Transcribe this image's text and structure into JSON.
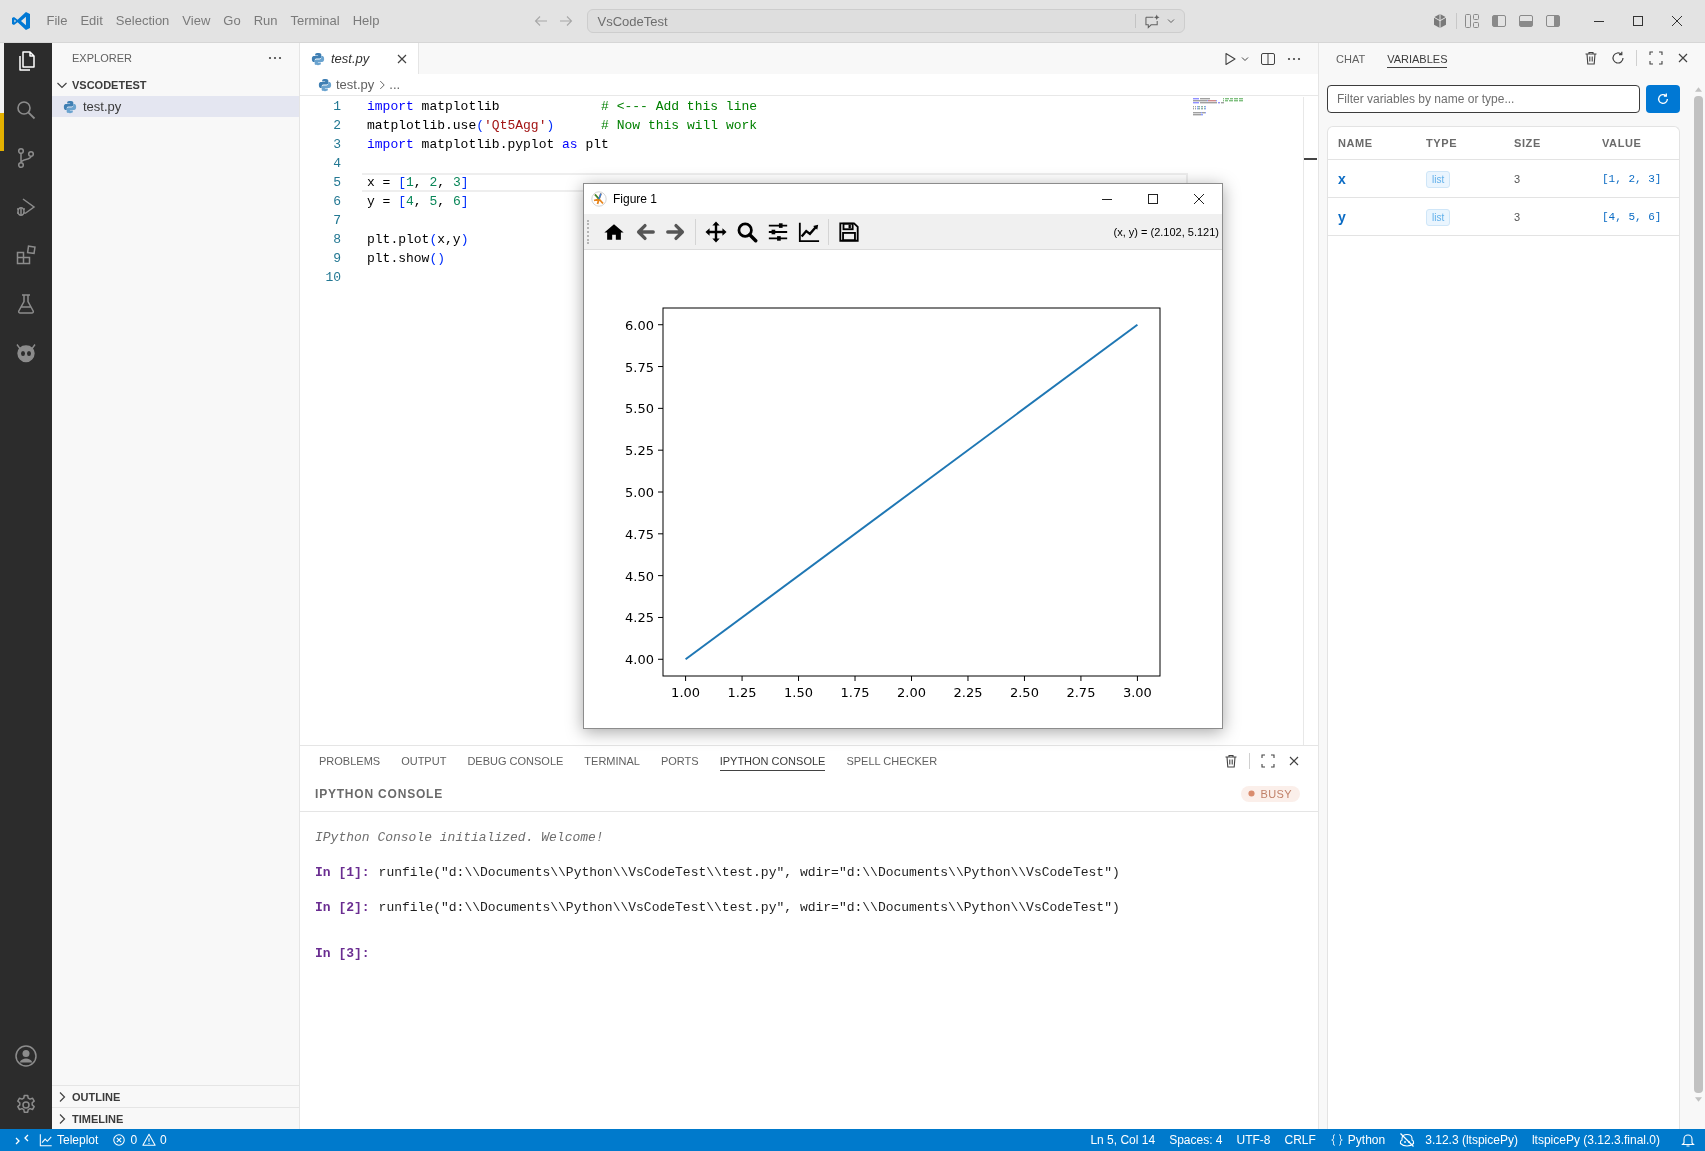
{
  "title_bar": {
    "menu": [
      "File",
      "Edit",
      "Selection",
      "View",
      "Go",
      "Run",
      "Terminal",
      "Help"
    ],
    "command_center": "VsCodeTest"
  },
  "activity_bar": {
    "items": [
      {
        "selected": true
      },
      {
        "selected": false
      },
      {
        "selected": false
      },
      {
        "selected": false
      },
      {
        "selected": false
      },
      {
        "selected": false
      },
      {
        "selected": false
      }
    ]
  },
  "sidebar": {
    "title": "EXPLORER",
    "folder": {
      "name": "VSCODETEST",
      "expanded": true,
      "children": [
        {
          "name": "test.py",
          "selected": true
        }
      ]
    },
    "sections": [
      {
        "name": "OUTLINE",
        "expanded": false
      },
      {
        "name": "TIMELINE",
        "expanded": false
      }
    ]
  },
  "editor": {
    "tabs": [
      {
        "label": "test.py",
        "selected": true,
        "preview": true
      }
    ],
    "breadcrumb": [
      "test.py",
      "..."
    ],
    "lines": [
      {
        "number": "1",
        "current": false,
        "tokens": [
          {
            "kind": "keyword",
            "text": "import"
          },
          {
            "kind": "plain",
            "text": " matplotlib             "
          },
          {
            "kind": "comment",
            "text": "# <--- Add this line"
          }
        ]
      },
      {
        "number": "2",
        "current": false,
        "tokens": [
          {
            "kind": "plain",
            "text": "matplotlib.use"
          },
          {
            "kind": "bracket",
            "text": "("
          },
          {
            "kind": "string",
            "text": "'Qt5Agg'"
          },
          {
            "kind": "bracket",
            "text": ")"
          },
          {
            "kind": "comment",
            "text": "      # Now this will work"
          }
        ]
      },
      {
        "number": "3",
        "current": false,
        "tokens": [
          {
            "kind": "keyword",
            "text": "import"
          },
          {
            "kind": "plain",
            "text": " matplotlib.pyplot "
          },
          {
            "kind": "keyword",
            "text": "as"
          },
          {
            "kind": "plain",
            "text": " plt"
          }
        ]
      },
      {
        "number": "4",
        "current": false
      },
      {
        "number": "5",
        "current": true,
        "tokens": [
          {
            "kind": "plain",
            "text": "x = "
          },
          {
            "kind": "bracket",
            "text": "["
          },
          {
            "kind": "number",
            "text": "1"
          },
          {
            "kind": "plain",
            "text": ", "
          },
          {
            "kind": "number",
            "text": "2"
          },
          {
            "kind": "plain",
            "text": ", "
          },
          {
            "kind": "number",
            "text": "3"
          },
          {
            "kind": "bracket",
            "text": "]"
          }
        ]
      },
      {
        "number": "6",
        "current": false,
        "tokens": [
          {
            "kind": "plain",
            "text": "y = "
          },
          {
            "kind": "bracket",
            "text": "["
          },
          {
            "kind": "number",
            "text": "4"
          },
          {
            "kind": "plain",
            "text": ", "
          },
          {
            "kind": "number",
            "text": "5"
          },
          {
            "kind": "plain",
            "text": ", "
          },
          {
            "kind": "number",
            "text": "6"
          },
          {
            "kind": "bracket",
            "text": "]"
          }
        ]
      },
      {
        "number": "7",
        "current": false
      },
      {
        "number": "8",
        "current": false,
        "tokens": [
          {
            "kind": "plain",
            "text": "plt.plot"
          },
          {
            "kind": "bracket",
            "text": "("
          },
          {
            "kind": "plain",
            "text": "x,y"
          },
          {
            "kind": "bracket",
            "text": ")"
          }
        ]
      },
      {
        "number": "9",
        "current": false,
        "tokens": [
          {
            "kind": "plain",
            "text": "plt.show"
          },
          {
            "kind": "bracket",
            "text": "()"
          }
        ]
      },
      {
        "number": "10",
        "current": false
      }
    ]
  },
  "figure_window": {
    "title": "Figure 1",
    "coordinates": "(x, y) = (2.102, 5.121)",
    "chart_data": [
      {
        "type": "line",
        "x": [
          1,
          2,
          3
        ],
        "values": [
          4,
          5,
          6
        ],
        "color": "#1f77b4",
        "xlim": [
          0.9,
          3.1
        ],
        "ylim": [
          3.9,
          6.1
        ],
        "xticks": [
          {
            "value": 1,
            "label": "1.00"
          },
          {
            "value": 1.25,
            "label": "1.25"
          },
          {
            "value": 1.5,
            "label": "1.50"
          },
          {
            "value": 1.75,
            "label": "1.75"
          },
          {
            "value": 2,
            "label": "2.00"
          },
          {
            "value": 2.25,
            "label": "2.25"
          },
          {
            "value": 2.5,
            "label": "2.50"
          },
          {
            "value": 2.75,
            "label": "2.75"
          },
          {
            "value": 3,
            "label": "3.00"
          }
        ],
        "yticks": [
          {
            "value": 4,
            "label": "4.00"
          },
          {
            "value": 4.25,
            "label": "4.25"
          },
          {
            "value": 4.5,
            "label": "4.50"
          },
          {
            "value": 4.75,
            "label": "4.75"
          },
          {
            "value": 5,
            "label": "5.00"
          },
          {
            "value": 5.25,
            "label": "5.25"
          },
          {
            "value": 5.5,
            "label": "5.50"
          },
          {
            "value": 5.75,
            "label": "5.75"
          },
          {
            "value": 6,
            "label": "6.00"
          }
        ]
      }
    ]
  },
  "panel": {
    "tabs": [
      {
        "label": "PROBLEMS",
        "selected": false
      },
      {
        "label": "OUTPUT",
        "selected": false
      },
      {
        "label": "DEBUG CONSOLE",
        "selected": false
      },
      {
        "label": "TERMINAL",
        "selected": false
      },
      {
        "label": "PORTS",
        "selected": false
      },
      {
        "label": "IPYTHON CONSOLE",
        "selected": true
      },
      {
        "label": "SPELL CHECKER",
        "selected": false
      }
    ],
    "title": "IPYTHON CONSOLE",
    "status": "BUSY",
    "lines": [
      {
        "kind": "info",
        "text": "IPython Console initialized. Welcome!"
      },
      {
        "kind": "input",
        "prompt": "In [1]:",
        "text": "runfile(\"d:\\\\Documents\\\\Python\\\\VsCodeTest\\\\test.py\", wdir=\"d:\\\\Documents\\\\Python\\\\VsCodeTest\")"
      },
      {
        "kind": "input",
        "prompt": "In [2]:",
        "text": "runfile(\"d:\\\\Documents\\\\Python\\\\VsCodeTest\\\\test.py\", wdir=\"d:\\\\Documents\\\\Python\\\\VsCodeTest\")"
      },
      {
        "kind": "input",
        "prompt": "In [3]:"
      }
    ]
  },
  "variables_panel": {
    "tabs": [
      {
        "label": "CHAT",
        "selected": false
      },
      {
        "label": "VARIABLES",
        "selected": true
      }
    ],
    "filter": {
      "placeholder": "Filter variables by name or type..."
    },
    "table": {
      "columns": [
        "NAME",
        "TYPE",
        "SIZE",
        "VALUE"
      ],
      "rows": [
        {
          "name": "x",
          "type": "list",
          "size": "3",
          "value": "[1, 2, 3]"
        },
        {
          "name": "y",
          "type": "list",
          "size": "3",
          "value": "[4, 5, 6]"
        }
      ]
    }
  },
  "status_bar": {
    "teleplot": "Teleplot",
    "errors": "0",
    "warnings": "0",
    "items": [
      "Ln 5, Col 14",
      "Spaces: 4",
      "UTF-8",
      "CRLF"
    ],
    "language": "Python",
    "interpreter": "3.12.3 (ltspicePy)",
    "kernel": "ltspicePy (3.12.3.final.0)"
  }
}
